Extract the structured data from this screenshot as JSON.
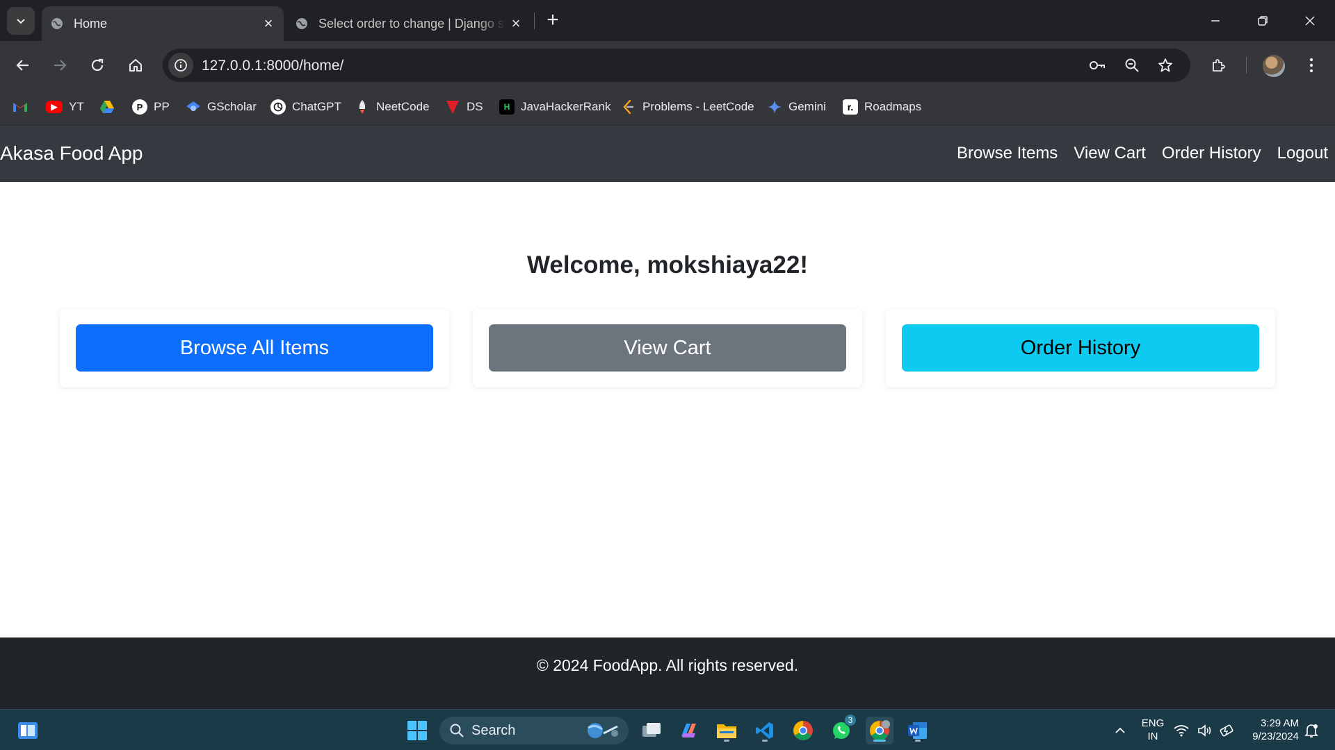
{
  "browser": {
    "tabs": [
      {
        "title": "Home",
        "active": true
      },
      {
        "title": "Select order to change | Django site admin",
        "active": false
      }
    ],
    "url": "127.0.0.1:8000/home/",
    "bookmarks": [
      {
        "label": ""
      },
      {
        "label": "YT"
      },
      {
        "label": ""
      },
      {
        "label": "PP"
      },
      {
        "label": "GScholar"
      },
      {
        "label": "ChatGPT"
      },
      {
        "label": "NeetCode"
      },
      {
        "label": "DS"
      },
      {
        "label": "JavaHackerRank"
      },
      {
        "label": "Problems - LeetCode"
      },
      {
        "label": "Gemini"
      },
      {
        "label": "Roadmaps"
      }
    ]
  },
  "app": {
    "brand": "Akasa Food App",
    "nav": [
      "Browse Items",
      "View Cart",
      "Order History",
      "Logout"
    ],
    "welcome": "Welcome, mokshiaya22!",
    "buttons": [
      {
        "label": "Browse All Items",
        "color": "#0d6efd",
        "text_color": "#ffffff"
      },
      {
        "label": "View Cart",
        "color": "#6c757d",
        "text_color": "#ffffff"
      },
      {
        "label": "Order History",
        "color": "#0dcaf0",
        "text_color": "#000000"
      }
    ],
    "footer": "© 2024 FoodApp. All rights reserved."
  },
  "taskbar": {
    "search_label": "Search",
    "whatsapp_badge": "3",
    "language": [
      "ENG",
      "IN"
    ],
    "time": "3:29 AM",
    "date": "9/23/2024"
  },
  "colors": {
    "navbar": "#343a40",
    "footer": "#212529",
    "taskbar": "#1b3a48"
  }
}
